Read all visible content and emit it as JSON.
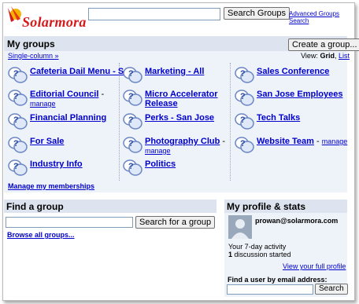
{
  "header": {
    "logo_text": "Solarmora",
    "search_placeholder": "",
    "search_button": "Search Groups",
    "advanced_search_link": "Advanced Groups Search"
  },
  "my_groups": {
    "title": "My groups",
    "create_button": "Create a group...",
    "single_column_link": "Single-column »",
    "view_label": "View:",
    "view_grid": "Grid",
    "view_separator": ",",
    "view_list": "List",
    "manage_memberships_link": "Manage my memberships",
    "manage_label": "manage",
    "groups": [
      {
        "name": "Cafeteria Dail Menu - SJ",
        "manage": false
      },
      {
        "name": "Editorial Council",
        "manage": true
      },
      {
        "name": "Financial Planning",
        "manage": false
      },
      {
        "name": "For Sale",
        "manage": false
      },
      {
        "name": "Industry Info",
        "manage": false
      },
      {
        "name": "Marketing - All",
        "manage": false
      },
      {
        "name": "Micro Accelerator Release",
        "manage": false
      },
      {
        "name": "Perks - San Jose",
        "manage": false
      },
      {
        "name": "Photography Club",
        "manage": true
      },
      {
        "name": "Politics",
        "manage": false
      },
      {
        "name": "Sales Conference",
        "manage": false
      },
      {
        "name": "San Jose Employees",
        "manage": false
      },
      {
        "name": "Tech Talks",
        "manage": false
      },
      {
        "name": "Website Team",
        "manage": true
      }
    ]
  },
  "find_group": {
    "title": "Find a group",
    "input_placeholder": "",
    "search_button": "Search for a group",
    "browse_link": "Browse all groups..."
  },
  "profile": {
    "title": "My profile & stats",
    "email": "prowan@solarmora.com",
    "activity_label": "Your 7-day activity",
    "discussion_count": "1",
    "discussion_text": "discussion started",
    "view_profile_link": "View your full profile",
    "find_user_label": "Find a user by email address:",
    "find_user_placeholder": "",
    "search_button": "Search"
  },
  "colors": {
    "panel_bg": "#eef2f9",
    "header_bg": "#dde4ef",
    "link": "#0000cc",
    "logo_red": "#d41a1a"
  }
}
